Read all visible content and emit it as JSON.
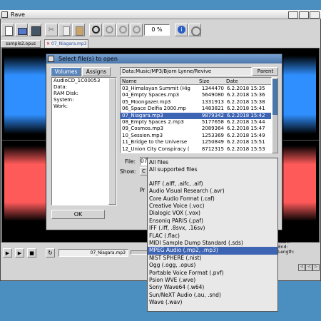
{
  "app": {
    "title": "Rave"
  },
  "toolbar": {
    "zoom_value": "0 %"
  },
  "tabs": [
    "sample2.opus",
    "07_Niagara.mp3"
  ],
  "transport": {
    "filename": "07_Niagara.mp3"
  },
  "info": {
    "line1": "Start:",
    "line2": "End:",
    "line3": "Length:"
  },
  "dialog": {
    "title": "Select file(s) to open",
    "tabs": [
      "Volumes",
      "Assigns"
    ],
    "volumes": [
      "AudioCD_1C00053",
      "Data:",
      "RAM Disk:",
      "System:",
      "Work:"
    ],
    "ok_label": "OK",
    "path": "Data:Music/MP3/Bjorn Lynne/Revive",
    "parent_label": "Parent",
    "columns": [
      "Name",
      "Size",
      "Date"
    ],
    "files": [
      {
        "name": "03_Himalayan Summit (Hig",
        "size": "1344470",
        "date": "6.2.2018 15:35"
      },
      {
        "name": "04_Empty Spaces.mp3",
        "size": "5649080",
        "date": "6.2.2018 15:36"
      },
      {
        "name": "05_Moongazer.mp3",
        "size": "1331913",
        "date": "6.2.2018 15:38"
      },
      {
        "name": "06_Space Delfia 2000.mp",
        "size": "1483821",
        "date": "6.2.2018 15:41"
      },
      {
        "name": "07_Niagara.mp3",
        "size": "9879342",
        "date": "6.2.2018 15:42"
      },
      {
        "name": "08_Empty Spaces 2.mp3",
        "size": "5177658",
        "date": "6.2.2018 15:44"
      },
      {
        "name": "09_Cosmos.mp3",
        "size": "2089364",
        "date": "6.2.2018 15:47"
      },
      {
        "name": "10_Session.mp3",
        "size": "1253369",
        "date": "6.2.2018 15:49"
      },
      {
        "name": "11_Bridge to the Universe",
        "size": "1250849",
        "date": "6.2.2018 15:51"
      },
      {
        "name": "12_Union City Conspiracy (",
        "size": "8712315",
        "date": "6.2.2018 15:53"
      }
    ],
    "file_label": "File:",
    "file_value": "07",
    "show_label": "Show:",
    "pr_label": "Pr"
  },
  "dropdown": {
    "items": [
      "All files",
      "All supported files",
      "",
      "AIFF (.aiff, .aifc, .aif)",
      "Audio Visual Research (.avr)",
      "Core Audio Format (.caf)",
      "Creative Voice (.voc)",
      "Dialogic VOX (.vox)",
      "Ensoniq PARIS (.paf)",
      "IFF (.iff, .8svx, .16sv)",
      "FLAC (.flac)",
      "MIDI Sample Dump Standard (.sds)",
      "MPEG Audio (.mp2, .mp3)",
      "NIST SPHERE (.nist)",
      "Ogg (.ogg, .opus)",
      "Portable Voice Format (.pvf)",
      "Psion WVE (.wve)",
      "Sony Wave64 (.w64)",
      "Sun/NeXT Audio (.au, .snd)",
      "Wave (.wav)"
    ],
    "selected_index": 12
  },
  "colors": {
    "selection": "#3e64b4",
    "wave_top": "#2f8fff",
    "wave_bottom": "#ff5a5a",
    "title_active": "#5a87b8"
  }
}
